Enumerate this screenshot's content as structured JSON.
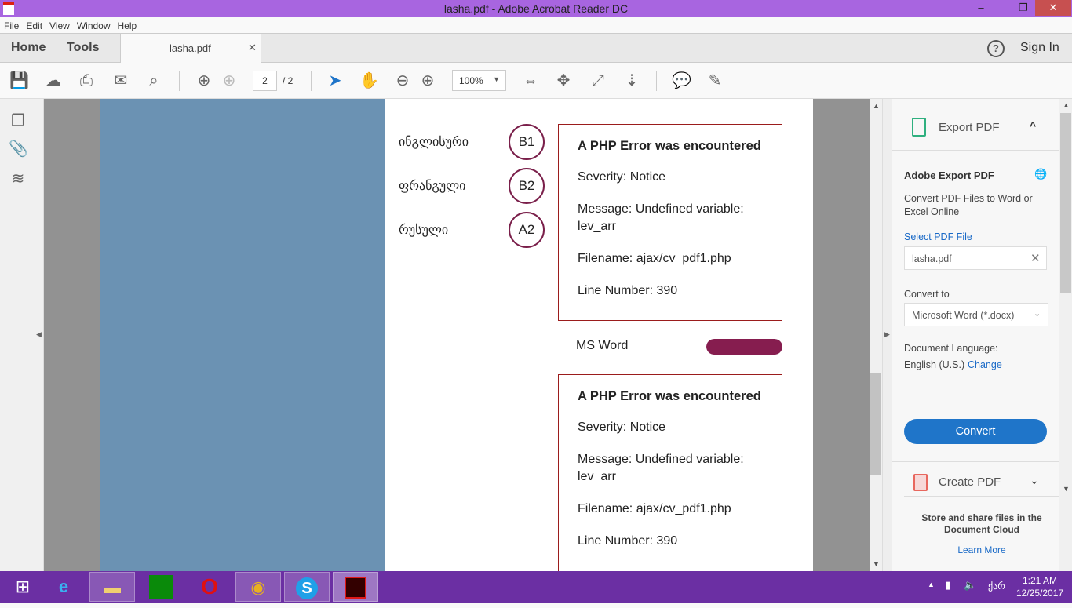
{
  "window": {
    "title": "lasha.pdf - Adobe Acrobat Reader DC"
  },
  "menu": [
    "File",
    "Edit",
    "View",
    "Window",
    "Help"
  ],
  "tabs": {
    "home": "Home",
    "tools": "Tools",
    "document": "lasha.pdf",
    "sign_in": "Sign In"
  },
  "toolbar": {
    "page_current": "2",
    "page_total": "/ 2",
    "zoom": "100%"
  },
  "document": {
    "languages": [
      {
        "name": "ინგლისური",
        "level": "B1"
      },
      {
        "name": "ფრანგული",
        "level": "B2"
      },
      {
        "name": "რუსული",
        "level": "A2"
      }
    ],
    "errors": [
      {
        "title": "A PHP Error was encountered",
        "severity": "Severity: Notice",
        "message": "Message: Undefined variable: lev_arr",
        "filename": "Filename: ajax/cv_pdf1.php",
        "line": "Line Number: 390"
      },
      {
        "title": "A PHP Error was encountered",
        "severity": "Severity: Notice",
        "message": "Message: Undefined variable: lev_arr",
        "filename": "Filename: ajax/cv_pdf1.php",
        "line": "Line Number: 390"
      }
    ],
    "skill": {
      "label": "MS Word",
      "level_fraction": 1.0
    }
  },
  "panel": {
    "export_title": "Export PDF",
    "heading": "Adobe Export PDF",
    "description": "Convert PDF Files to Word or Excel Online",
    "select_label": "Select PDF File",
    "file": "lasha.pdf",
    "convert_to_label": "Convert to",
    "convert_to_value": "Microsoft Word (*.docx)",
    "doc_lang_label": "Document Language:",
    "doc_lang_value": "English (U.S.)",
    "change": "Change",
    "convert_button": "Convert",
    "create_title": "Create PDF",
    "cloud_text": "Store and share files in the Document Cloud",
    "learn_more": "Learn More"
  },
  "taskbar": {
    "time": "1:21 AM",
    "date": "12/25/2017",
    "lang": "ქარ"
  },
  "colors": {
    "titlebar": "#a865e0",
    "taskbar": "#6b2fa3",
    "accent": "#1f75c9",
    "error_border": "#9b1c1c",
    "level_circle": "#7a1f4a"
  }
}
